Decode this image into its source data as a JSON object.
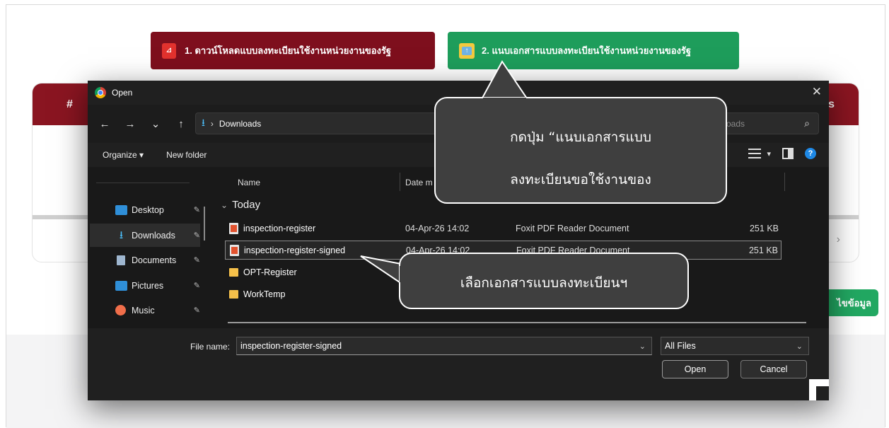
{
  "page": {
    "download_button": "1. ดาวน์โหลดแบบลงทะเบียนใช้งานหน่วยงานของรัฐ",
    "attach_button": "2. แนบเอกสารแบบลงทะเบียนใช้งานหน่วยงานของรัฐ",
    "table_hash": "#",
    "table_right_fragment": "s",
    "edit_button": "ไขข้อมูล",
    "chevron": "›"
  },
  "dialog": {
    "title": "Open",
    "close": "✕",
    "nav": {
      "back": "←",
      "forward": "→",
      "recent": "⌄",
      "up": "↑"
    },
    "address": {
      "icon": "⭳",
      "separator": "›",
      "folder": "Downloads"
    },
    "search_placeholder": "oads",
    "search_icon": "⌕",
    "commands": {
      "organize": "Organize ▾",
      "new_folder": "New folder"
    },
    "help": "?",
    "view_chev": "▾",
    "sidebar": [
      {
        "label": "Desktop",
        "icon": "desktop-icon",
        "pin": "📌"
      },
      {
        "label": "Downloads",
        "icon": "downloads-icon",
        "pin": "📌",
        "selected": true
      },
      {
        "label": "Documents",
        "icon": "documents-icon",
        "pin": "📌"
      },
      {
        "label": "Pictures",
        "icon": "pictures-icon",
        "pin": "📌"
      },
      {
        "label": "Music",
        "icon": "music-icon",
        "pin": "📌"
      }
    ],
    "columns": {
      "name": "Name",
      "date": "Date m"
    },
    "group": {
      "chevron": "⌄",
      "label": "Today"
    },
    "files": [
      {
        "name": "inspection-register",
        "date": "04-Apr-26 14:02",
        "type": "Foxit PDF Reader Document",
        "size": "251 KB",
        "kind": "pdf"
      },
      {
        "name": "inspection-register-signed",
        "date": "04-Apr-26 14:02",
        "type": "Foxit PDF Reader Document",
        "size": "251 KB",
        "kind": "pdf",
        "selected": true
      },
      {
        "name": "OPT-Register",
        "date": "",
        "type": "",
        "size": "",
        "kind": "folder"
      },
      {
        "name": "WorkTemp",
        "date": "",
        "type": "",
        "size": "",
        "kind": "folder"
      }
    ],
    "footer": {
      "file_name_label": "File name:",
      "file_name_value": "inspection-register-signed",
      "filter": "All Files",
      "chev": "⌄",
      "open": "Open",
      "cancel": "Cancel"
    }
  },
  "callouts": {
    "attach_line1": "กดปุ่ม “แนบเอกสารแบบ",
    "attach_line2": "ลงทะเบียนขอใช้งานของ",
    "select": "เลือกเอกสารแบบลงทะเบียนฯ"
  },
  "colors": {
    "download_red": "#7e0f1d",
    "attach_green": "#1e9d5b",
    "dialog_bg": "#202020",
    "callout_bg": "#3f3f3f"
  }
}
